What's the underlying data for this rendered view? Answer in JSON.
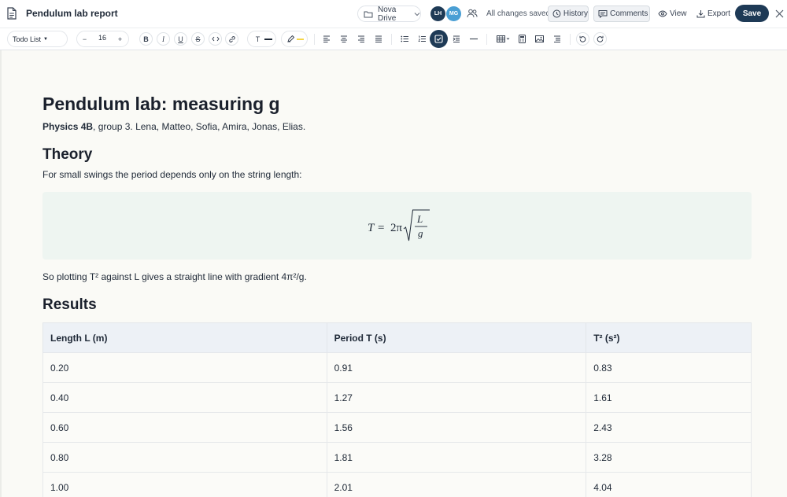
{
  "header": {
    "doc_title": "Pendulum lab report",
    "drive_label": "Nova Drive",
    "avatars": [
      "LH",
      "MG"
    ],
    "save_status": "All changes saved",
    "history_label": "History",
    "comments_label": "Comments",
    "view_label": "View",
    "export_label": "Export",
    "save_label": "Save",
    "icons": [
      "document-icon",
      "folder-icon",
      "chevron-down-icon",
      "collaborators-icon",
      "clock-icon",
      "comment-icon",
      "eye-icon",
      "download-icon",
      "close-icon"
    ]
  },
  "toolbar": {
    "block_style": "Todo List",
    "font_size": "16",
    "decrease_label": "−",
    "increase_label": "+",
    "bold_label": "B",
    "italic_label": "I",
    "underline_label": "U",
    "strike_label": "S",
    "text_color_label": "T",
    "active_tool": "todo-list",
    "icons": [
      "code-icon",
      "link-icon",
      "text-color-icon",
      "highlight-icon",
      "align-left-icon",
      "align-center-icon",
      "align-right-icon",
      "align-justify-icon",
      "bullet-list-icon",
      "numbered-list-icon",
      "todo-list-icon",
      "indent-icon",
      "horizontal-rule-icon",
      "table-icon",
      "calculator-icon",
      "image-icon",
      "outline-icon",
      "undo-icon",
      "redo-icon"
    ]
  },
  "document": {
    "title": "Pendulum lab: measuring g",
    "meta_bold": "Physics 4B",
    "meta_rest": ", group 3. Lena, Matteo, Sofia, Amira, Jonas, Elias.",
    "theory_heading": "Theory",
    "theory_text": "For small swings the period depends only on the string length:",
    "formula": {
      "lhs": "T",
      "equals": "=",
      "coef": "2π",
      "numerator": "L",
      "denominator": "g"
    },
    "gradient_text": "So plotting T² against L gives a straight line with gradient 4π²/g.",
    "results_heading": "Results",
    "table": {
      "headers": [
        "Length L (m)",
        "Period T (s)",
        "T² (s²)"
      ],
      "rows": [
        [
          "0.20",
          "0.91",
          "0.83"
        ],
        [
          "0.40",
          "1.27",
          "1.61"
        ],
        [
          "0.60",
          "1.56",
          "2.43"
        ],
        [
          "0.80",
          "1.81",
          "3.28"
        ],
        [
          "1.00",
          "2.01",
          "4.04"
        ]
      ]
    }
  },
  "colors": {
    "primary": "#1e3a56",
    "avatar_secondary": "#4a9fd4",
    "formula_bg": "#eef5f1",
    "table_header_bg": "#edf1f6",
    "highlight_yellow": "#f5d547"
  }
}
